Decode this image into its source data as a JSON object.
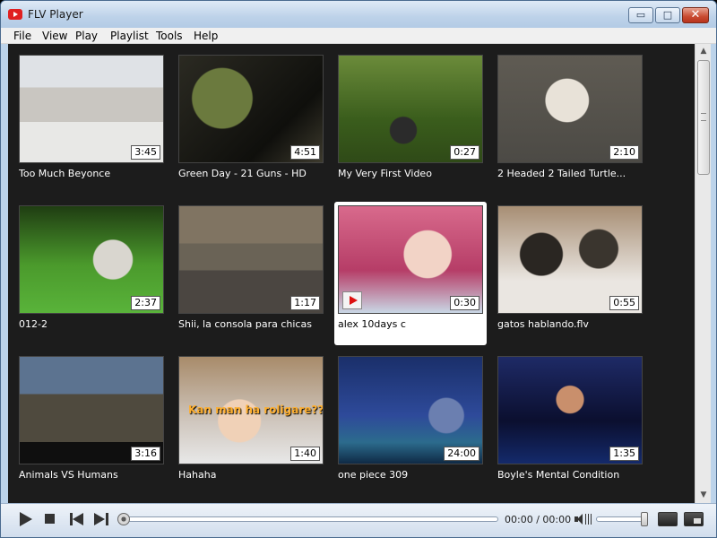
{
  "window": {
    "title": "FLV Player",
    "buttons": {
      "minimize": "▭",
      "maximize": "□",
      "close": "✕"
    }
  },
  "menu": [
    "File",
    "View",
    "Play",
    "Playlist",
    "Tools",
    "Help"
  ],
  "videos": [
    {
      "title": "Too Much Beyonce",
      "duration": "3:45"
    },
    {
      "title": "Green Day -  21 Guns  - HD",
      "duration": "4:51"
    },
    {
      "title": "My Very First Video",
      "duration": "0:27"
    },
    {
      "title": "2 Headed 2 Tailed Turtle...",
      "duration": "2:10"
    },
    {
      "title": "012-2",
      "duration": "2:37"
    },
    {
      "title": "Shii, la consola para chicas",
      "duration": "1:17"
    },
    {
      "title": "alex 10days c",
      "duration": "0:30",
      "selected": true
    },
    {
      "title": "gatos hablando.flv",
      "duration": "0:55"
    },
    {
      "title": "Animals VS Humans",
      "duration": "3:16"
    },
    {
      "title": "Hahaha",
      "duration": "1:40",
      "overlay_text": "Kan man ha roligare??"
    },
    {
      "title": "one piece 309",
      "duration": "24:00"
    },
    {
      "title": "Boyle's Mental Condition",
      "duration": "1:35"
    }
  ],
  "player": {
    "time_display": "00:00 / 00:00",
    "seek_fraction": 0.0,
    "volume_fraction": 1.0
  },
  "icons": {
    "play": "play-icon",
    "stop": "stop-icon",
    "prev": "previous-icon",
    "next": "next-icon",
    "volume": "volume-icon"
  }
}
